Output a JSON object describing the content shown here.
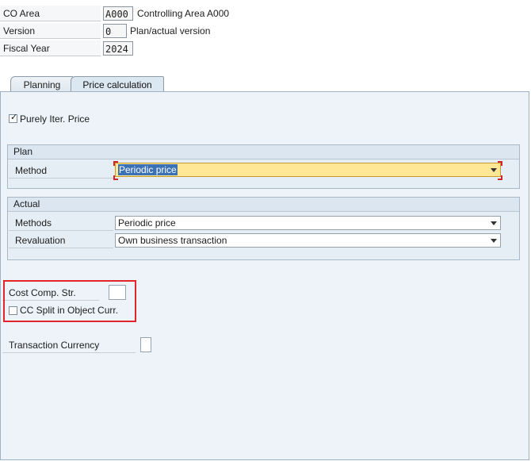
{
  "header": {
    "co_area": {
      "label": "CO Area",
      "value": "A000",
      "description": "Controlling Area A000"
    },
    "version": {
      "label": "Version",
      "value": "0",
      "description": "Plan/actual version"
    },
    "fiscal_year": {
      "label": "Fiscal Year",
      "value": "2024"
    }
  },
  "tabs": [
    {
      "label": "Planning",
      "active": false
    },
    {
      "label": "Price calculation",
      "active": true
    }
  ],
  "purely_iter_price": {
    "label": "Purely Iter. Price",
    "checked": true
  },
  "plan_group": {
    "title": "Plan",
    "method": {
      "label": "Method",
      "value": "Periodic price"
    }
  },
  "actual_group": {
    "title": "Actual",
    "methods": {
      "label": "Methods",
      "value": "Periodic price"
    },
    "revaluation": {
      "label": "Revaluation",
      "value": "Own business transaction"
    }
  },
  "cost_comp": {
    "label": "Cost Comp. Str.",
    "value": ""
  },
  "cc_split": {
    "label": "CC Split in Object Curr.",
    "checked": false
  },
  "transaction_currency": {
    "label": "Transaction Currency",
    "value": ""
  },
  "colors": {
    "highlight": "#e0252c",
    "focus_field": "#ffe795",
    "panel": "#edf3f8"
  }
}
